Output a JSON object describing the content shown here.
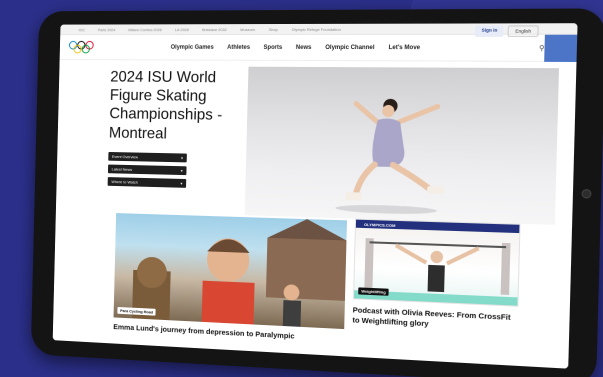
{
  "topstrip": {
    "links": [
      "IOC",
      "Paris 2024",
      "Milano Cortina 2026",
      "LA 2028",
      "Brisbane 2032",
      "Museum",
      "Shop",
      "Olympic Refuge Foundation"
    ]
  },
  "nav": {
    "items": [
      "Olympic Games",
      "Athletes",
      "Sports",
      "News",
      "Olympic Channel",
      "Let's Move"
    ],
    "signin": "Sign in",
    "language": "English"
  },
  "hero": {
    "title": "2024 ISU World Figure Skating Championships - Montreal",
    "buttons": [
      "Event Overview",
      "Latest News",
      "Where to Watch"
    ]
  },
  "cards": [
    {
      "tag": "Para Cycling Road",
      "title": "Emma Lund's journey from depression to Paralympic"
    },
    {
      "brand": "OLYMPICS.COM",
      "tag": "Weightlifting",
      "title": "Podcast with Olivia Reeves: From CrossFit to Weightlifting glory"
    }
  ],
  "colors": {
    "background": "#2b2f8a",
    "accent": "#4c74c7",
    "ring_blue": "#0085c7",
    "ring_yellow": "#f4c300",
    "ring_black": "#000000",
    "ring_green": "#009f3d",
    "ring_red": "#df0024"
  }
}
